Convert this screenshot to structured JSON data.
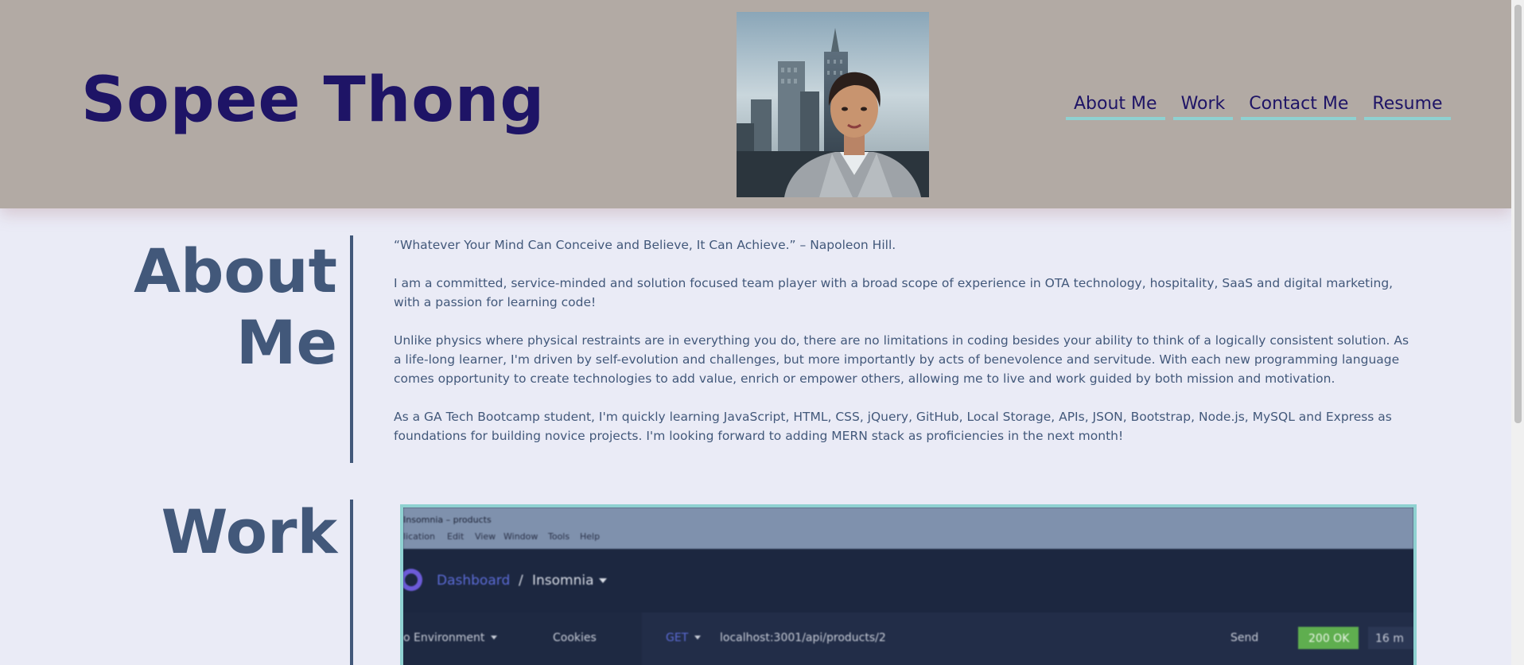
{
  "header": {
    "title": "Sopee Thong",
    "nav": [
      "About Me",
      "Work",
      "Contact Me",
      "Resume"
    ]
  },
  "about": {
    "heading": "About Me",
    "paragraphs": [
      "“Whatever Your Mind Can Conceive and Believe, It Can Achieve.” – Napoleon Hill.",
      "I am a committed, service-minded and solution focused team player with a broad scope of experience in OTA technology, hospitality, SaaS and digital marketing, with a passion for learning code!",
      "Unlike physics where physical restraints are in everything you do, there are no limitations in coding besides your ability to think of a logically consistent solution. As a life-long learner, I'm driven by self-evolution and challenges, but more importantly by acts of benevolence and servitude. With each new programming language comes opportunity to create technologies to add value, enrich or empower others, allowing me to live and work guided by both mission and motivation.",
      "As a GA Tech Bootcamp student, I'm quickly learning JavaScript, HTML, CSS, jQuery, GitHub, Local Storage, APIs, JSON, Bootstrap, Node.js, MySQL and Express as foundations for building novice projects. I'm looking forward to adding MERN stack as proficiencies in the next month!"
    ]
  },
  "work": {
    "heading": "Work",
    "screenshot": {
      "app_title": "Insomnia – products",
      "menu": [
        "lication",
        "Edit",
        "View",
        "Window",
        "Tools",
        "Help"
      ],
      "breadcrumb_link": "Dashboard",
      "breadcrumb_sep": "/",
      "breadcrumb_current": "Insomnia",
      "environment": "o Environment",
      "cookies": "Cookies",
      "method": "GET",
      "url": "localhost:3001/api/products/2",
      "send": "Send",
      "status": "200 OK",
      "time": "16 m"
    }
  },
  "colors": {
    "header_bg": "#b2aaa4",
    "title": "#1e1466",
    "nav_underline": "#8fd1d1",
    "heading": "#42587a",
    "page_bg": "#eaebf6"
  }
}
